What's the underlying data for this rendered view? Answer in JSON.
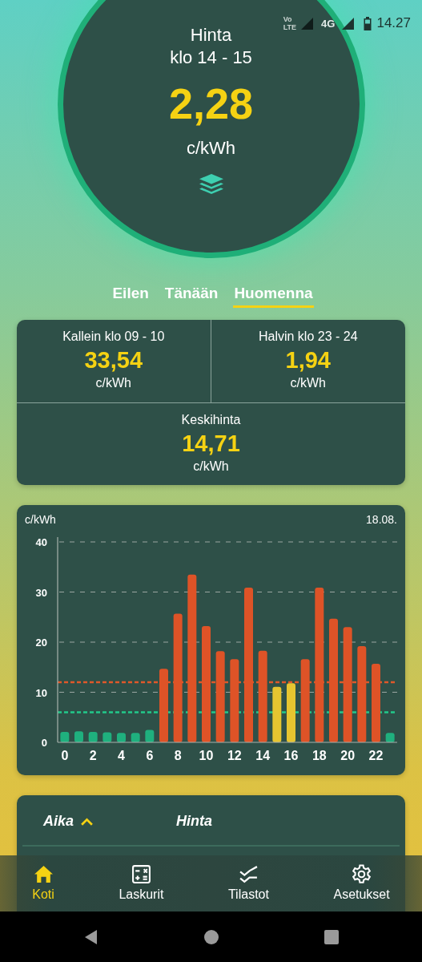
{
  "status_bar": {
    "volte": [
      "Vo",
      "LTE"
    ],
    "network": "4G",
    "time": "14.27"
  },
  "price_circle": {
    "title": "Hinta",
    "hour": "klo 14 - 15",
    "price": "2,28",
    "unit": "c/kWh"
  },
  "day_tabs": [
    {
      "label": "Eilen",
      "selected": false
    },
    {
      "label": "Tänään",
      "selected": false
    },
    {
      "label": "Huomenna",
      "selected": true
    }
  ],
  "summary": [
    {
      "label": "Kallein klo 09 - 10",
      "value": "33,54",
      "unit": "c/kWh"
    },
    {
      "label": "Halvin klo 23 - 24",
      "value": "1,94",
      "unit": "c/kWh"
    },
    {
      "label": "Keskihinta",
      "value": "14,71",
      "unit": "c/kWh"
    }
  ],
  "chart": {
    "unit_label": "c/kWh",
    "date": "18.08.",
    "chart_data": {
      "type": "bar",
      "x": [
        0,
        1,
        2,
        3,
        4,
        5,
        6,
        7,
        8,
        9,
        10,
        11,
        12,
        13,
        14,
        15,
        16,
        17,
        18,
        19,
        20,
        21,
        22,
        23
      ],
      "series": [
        {
          "color": "#1fb07e",
          "values": [
            2.1,
            2.2,
            2.1,
            2.0,
            1.9,
            1.9,
            2.5,
            null,
            null,
            null,
            null,
            null,
            null,
            null,
            null,
            null,
            null,
            null,
            null,
            null,
            null,
            null,
            null,
            1.9
          ]
        },
        {
          "color": "#e6c530",
          "values": [
            null,
            null,
            null,
            null,
            null,
            null,
            null,
            null,
            null,
            null,
            null,
            null,
            null,
            null,
            null,
            11.1,
            11.8,
            null,
            null,
            null,
            null,
            null,
            null,
            null
          ]
        },
        {
          "color": "#de5327",
          "values": [
            null,
            null,
            null,
            null,
            null,
            null,
            null,
            14.7,
            25.7,
            33.5,
            23.2,
            18.2,
            16.6,
            30.9,
            18.3,
            null,
            null,
            16.6,
            30.9,
            24.7,
            23.0,
            19.2,
            15.7,
            null
          ]
        }
      ],
      "xlim": [
        -0.5,
        23.5
      ],
      "ylim": [
        0,
        40
      ],
      "yticks": [
        0,
        10,
        20,
        30,
        40
      ],
      "xticks": [
        0,
        2,
        4,
        6,
        8,
        10,
        12,
        14,
        16,
        18,
        20,
        22
      ],
      "grid": true,
      "ref_lines": [
        {
          "axis": "y",
          "value": 12,
          "color": "#e0582a"
        },
        {
          "axis": "y",
          "value": 6,
          "color": "#22c98a"
        }
      ]
    }
  },
  "table": {
    "columns": [
      {
        "label": "Aika",
        "sorted": true
      },
      {
        "label": "Hinta",
        "sorted": false
      }
    ]
  },
  "bottom_nav": [
    {
      "label": "Koti",
      "kind": "home",
      "selected": true
    },
    {
      "label": "Laskurit",
      "kind": "calculator",
      "selected": false
    },
    {
      "label": "Tilastot",
      "kind": "stats",
      "selected": false
    },
    {
      "label": "Asetukset",
      "kind": "settings",
      "selected": false
    }
  ]
}
